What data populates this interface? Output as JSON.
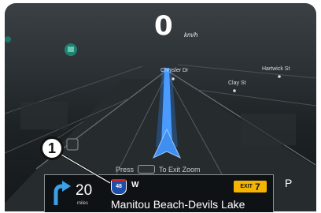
{
  "speedometer": {
    "speed": "0",
    "unit": "km/h"
  },
  "map": {
    "streets": [
      "Chrysler Dr",
      "Hartwick St",
      "Clay St"
    ],
    "route_color": "#2f7fe0",
    "poi_color": "#1a8f7a"
  },
  "zoom_hint": {
    "press": "Press",
    "exit": "To Exit Zoom"
  },
  "gear": "P",
  "next_turn": {
    "icon": "curve-right-arrow-icon",
    "distance": "20",
    "distance_unit": "miles",
    "highway_number": "48",
    "direction": "W",
    "exit_label": "EXIT",
    "exit_number": "7",
    "destination": "Manitou Beach-Devils Lake",
    "exit_color": "#f5b400"
  },
  "callout": {
    "number": "1"
  }
}
